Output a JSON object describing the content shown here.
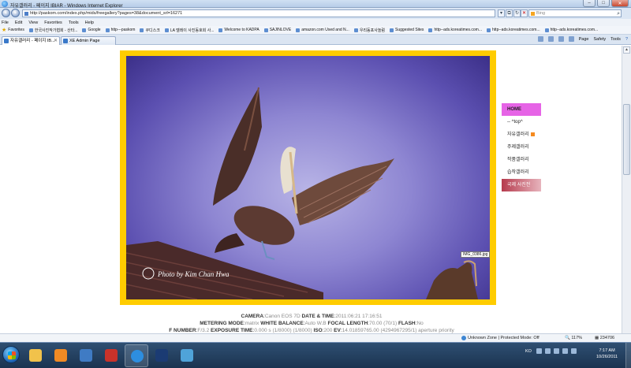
{
  "window": {
    "title": "자유갤러리 - 페이지 IBIAR - Windows Internet Explorer"
  },
  "address": {
    "url": "http://paskom.com/index.php/mids/freegallery?pages=38&document_srl=16271",
    "search_placeholder": "Bing"
  },
  "menu": [
    "File",
    "Edit",
    "View",
    "Favorites",
    "Tools",
    "Help"
  ],
  "favorites": {
    "label": "Favorites",
    "items": [
      "한국사진작가협회 - 산타...",
      "Google",
      "http---paskom",
      "쿠디스크",
      "LA 델레이 사진동호회 사...",
      "Welcome to KADPA",
      "SAJINLOVE",
      "amazon.com Used and N...",
      "우리동포사놀럼",
      "Suggested Sites",
      "http--ads.koreatimes.com...",
      "http--ads.koreatimes.com...",
      "http--ads.koreatimes.com..."
    ]
  },
  "tabs": [
    {
      "label": "자유갤러리 - 페이지 IB..."
    },
    {
      "label": "XE Admin Page"
    }
  ],
  "commandbar": [
    "Page",
    "Safety",
    "Tools"
  ],
  "sidemenu": {
    "items": [
      {
        "label": "HOME"
      },
      {
        "label": "-- ^top^"
      },
      {
        "label": "자유갤러리"
      },
      {
        "label": "주제갤러리"
      },
      {
        "label": "작품갤러리"
      },
      {
        "label": "습작갤러리"
      },
      {
        "label": "국제 사진전"
      }
    ]
  },
  "photo": {
    "filename": "IMG_0386.jpg",
    "watermark": "Photo by Kim Chan Hwa"
  },
  "exif": {
    "camera_label": "CAMERA",
    "camera": "Canon EOS 7D",
    "datetime_label": "DATE & TIME",
    "datetime": "2011:06:21 17:16:51",
    "metering_label": "METERING MODE",
    "metering": "matrix",
    "wb_label": "WHITE BALANCE",
    "wb": "Auto W.B",
    "focal_label": "FOCAL LENGTH",
    "focal": "70.00 (70/1)",
    "flash_label": "FLASH",
    "flash": "No",
    "fnumber_label": "F NUMBER",
    "fnumber": "F/3.2",
    "exposure_label": "EXPOSURE TIME",
    "exposure": "0.000 s (1/8000) (1/8000)",
    "iso_label": "ISO",
    "iso": "200",
    "ev_label": "EV",
    "ev": "14.01859765.00 (4294967295/1)",
    "aperture": "aperture priority"
  },
  "status": {
    "zone": "Unknown Zone | Protected Mode: Off",
    "zoom": "117%",
    "counter": "234706"
  },
  "taskbar": {
    "keyboard": "KO",
    "time": "7:17 AM",
    "date": "10/26/2011"
  }
}
